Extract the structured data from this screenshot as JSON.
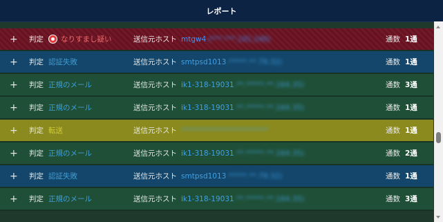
{
  "header": {
    "title": "レポート"
  },
  "labels": {
    "judgment": "判定",
    "sender_host": "送信元ホスト",
    "count": "通数"
  },
  "rows": [
    {
      "status": "danger",
      "verdict": "なりすまし疑い",
      "host_visible": "mtgw4",
      "host_blurred": ".(***.***.191.240)",
      "count": "1通",
      "icon": "warning-circle-icon"
    },
    {
      "status": "fail",
      "verdict": "認証失敗",
      "host_visible": "smtpsd1013",
      "host_blurred": ".*****.**.79.32)",
      "count": "1通"
    },
    {
      "status": "ok",
      "verdict": "正規のメール",
      "host_visible": "ik1-318-19031",
      "host_blurred": ".**.*****.**.164.35)",
      "count": "3通"
    },
    {
      "status": "ok",
      "verdict": "正規のメール",
      "host_visible": "ik1-318-19031",
      "host_blurred": ".**.*****.**.164.35)",
      "count": "1通"
    },
    {
      "status": "warn",
      "verdict": "転送",
      "host_visible": "",
      "host_blurred": "************************",
      "count": "1通"
    },
    {
      "status": "ok",
      "verdict": "正規のメール",
      "host_visible": "ik1-318-19031",
      "host_blurred": ".**.*****.**.164.35)",
      "count": "2通"
    },
    {
      "status": "fail",
      "verdict": "認証失敗",
      "host_visible": "smtpsd1013",
      "host_blurred": ".*****.**.79.32)",
      "count": "1通"
    },
    {
      "status": "ok",
      "verdict": "正規のメール",
      "host_visible": "ik1-318-19031",
      "host_blurred": ".**.*****.**.164.35)",
      "count": "3通"
    }
  ],
  "colors": {
    "danger": "#6b1322",
    "fail": "#13466a",
    "ok": "#1f4f36",
    "warn": "#8b8a1e",
    "header": "#0d2344"
  }
}
